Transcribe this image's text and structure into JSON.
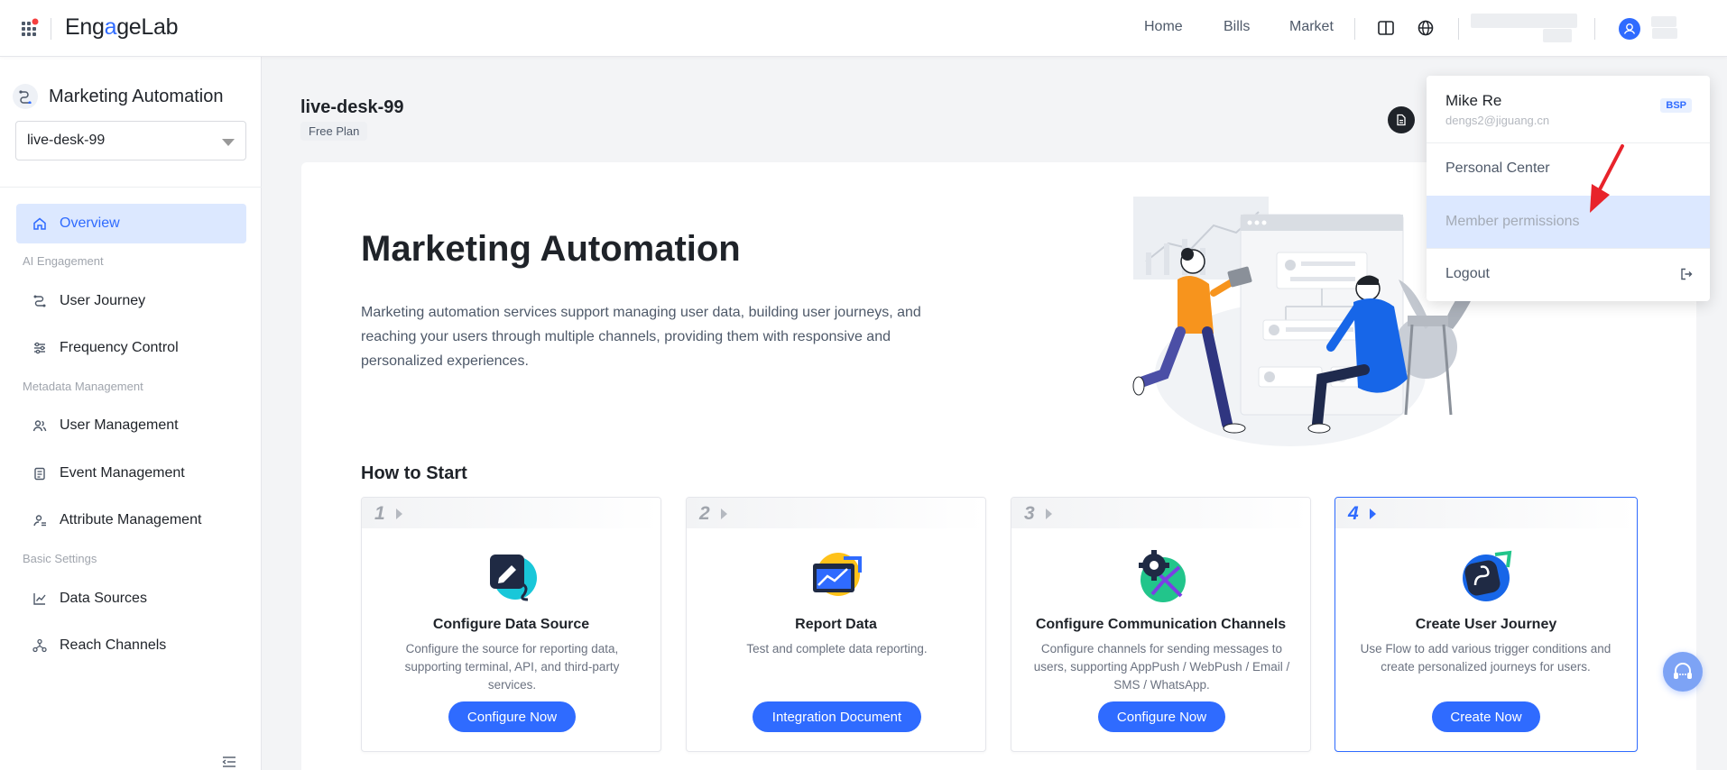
{
  "topbar": {
    "logo_part1": "Eng",
    "logo_part2": "a",
    "logo_part3": "geLab",
    "nav": [
      "Home",
      "Bills",
      "Market"
    ]
  },
  "sidebar": {
    "title": "Marketing Automation",
    "project": "live-desk-99",
    "overview": "Overview",
    "groups": {
      "ai": "AI Engagement",
      "metadata": "Metadata Management",
      "basic": "Basic Settings"
    },
    "items": {
      "user_journey": "User Journey",
      "frequency_control": "Frequency Control",
      "user_management": "User Management",
      "event_management": "Event Management",
      "attribute_management": "Attribute Management",
      "data_sources": "Data Sources",
      "reach_channels": "Reach Channels"
    }
  },
  "main": {
    "project_name": "live-desk-99",
    "plan": "Free Plan",
    "hero_title": "Marketing Automation",
    "hero_desc": "Marketing automation services support managing user data, building user journeys, and reaching your users through multiple channels, providing them with responsive and personalized experiences.",
    "how_title": "How to Start",
    "steps": [
      {
        "num": "1",
        "title": "Configure Data Source",
        "desc": "Configure the source for reporting data, supporting terminal, API, and third-party services.",
        "button": "Configure Now"
      },
      {
        "num": "2",
        "title": "Report Data",
        "desc": "Test and complete data reporting.",
        "button": "Integration Document"
      },
      {
        "num": "3",
        "title": "Configure Communication Channels",
        "desc": "Configure channels for sending messages to users, supporting AppPush / WebPush / Email / SMS / WhatsApp.",
        "button": "Configure Now"
      },
      {
        "num": "4",
        "title": "Create User Journey",
        "desc": "Use Flow to add various trigger conditions and create personalized journeys for users.",
        "button": "Create Now"
      }
    ]
  },
  "dropdown": {
    "name": "Mike Re",
    "email": "dengs2@jiguang.cn",
    "badge": "BSP",
    "personal_center": "Personal Center",
    "member_permissions": "Member permissions",
    "logout": "Logout"
  },
  "colors": {
    "accent": "#2f6bff",
    "active_bg": "#dce8ff"
  }
}
